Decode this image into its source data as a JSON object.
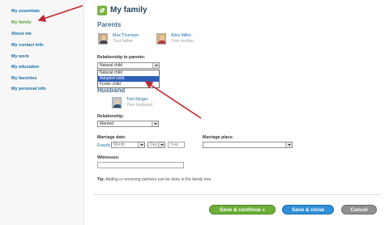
{
  "sidebar": {
    "items": [
      {
        "label": "My essentials"
      },
      {
        "label": "My family"
      },
      {
        "label": "About me"
      },
      {
        "label": "My contact info"
      },
      {
        "label": "My work"
      },
      {
        "label": "My education"
      },
      {
        "label": "My favorites"
      },
      {
        "label": "My personal info"
      }
    ]
  },
  "header": {
    "title": "My family",
    "icon": "family-leaf-icon"
  },
  "parents": {
    "title": "Parents",
    "people": [
      {
        "name": "Max Thurman",
        "role": "Your father"
      },
      {
        "name": "Alice Miller",
        "role": "Your mother"
      }
    ],
    "relationship_label": "Relationship to parents:",
    "relationship_value": "Natural child",
    "options": [
      "Natural child",
      "Adopted child",
      "Foster child"
    ],
    "highlighted_option": "Adopted child"
  },
  "husband": {
    "title": "Husband",
    "name": "Tom Ringer",
    "role": "Your husband",
    "relationship_label": "Relationship:",
    "relationship_value": "Married",
    "marriage_date_label": "Marriage date:",
    "exactly_label": "Exactly",
    "month_placeholder": "Month",
    "day_placeholder": "Day",
    "year_placeholder": "Year",
    "marriage_place_label": "Marriage place:",
    "witnesses_label": "Witnesses:"
  },
  "tip": {
    "prefix": "Tip:",
    "text": "Adding or removing partners can be done in the family tree"
  },
  "buttons": {
    "save_continue": "Save & continue »",
    "save_close": "Save & close",
    "cancel": "Cancel"
  },
  "colors": {
    "accent_green": "#6cae3a",
    "accent_blue": "#2f8fd8",
    "link_blue": "#1a6ea8",
    "arrow_red": "#c0262d"
  }
}
